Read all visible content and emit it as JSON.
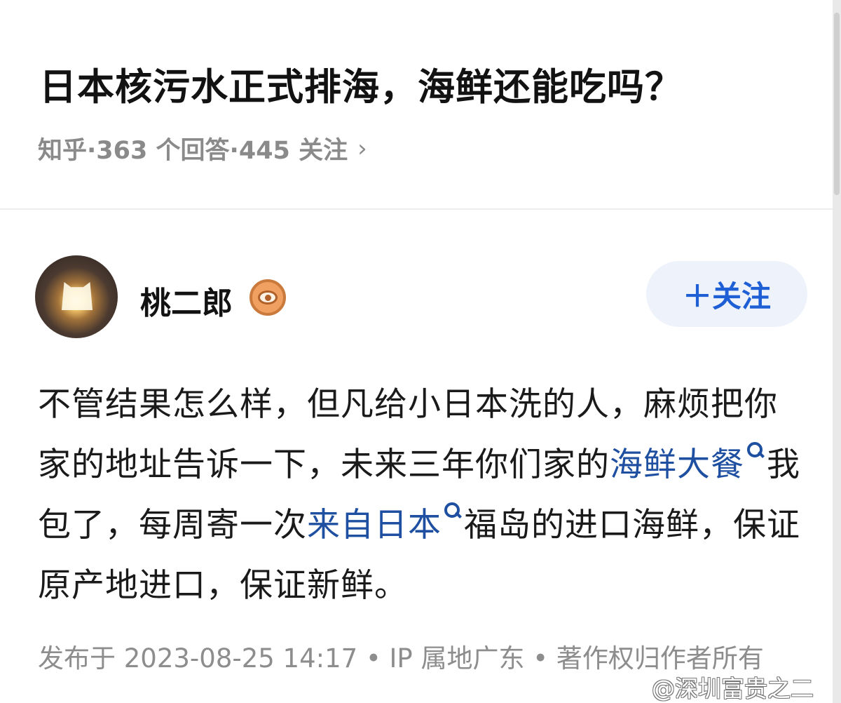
{
  "question": {
    "title": "日本核污水正式排海，海鲜还能吃吗？",
    "meta": "知乎·363 个回答·445 关注",
    "meta_chevron": "›"
  },
  "author": {
    "name": "桃二郎",
    "follow_label": "＋关注"
  },
  "answer": {
    "part1": "不管结果怎么样，但凡给小日本洗的人，麻烦把你家的地址告诉一下，未来三年你们家的",
    "keyword1": "海鲜大餐",
    "part2": "我包了，每周寄一次",
    "keyword2": "来自日本",
    "part3": "福岛的进口海鲜，保证原产地进口，保证新鲜。"
  },
  "footer": {
    "meta": "发布于 2023-08-25 14:17 • IP 属地广东 • 著作权归作者所有"
  },
  "watermark": "@深圳富贵之二",
  "colors": {
    "link": "#1e4fa0",
    "follow_text": "#1f5fd6",
    "follow_bg": "#eef3fb",
    "muted": "#8a8a8a"
  }
}
